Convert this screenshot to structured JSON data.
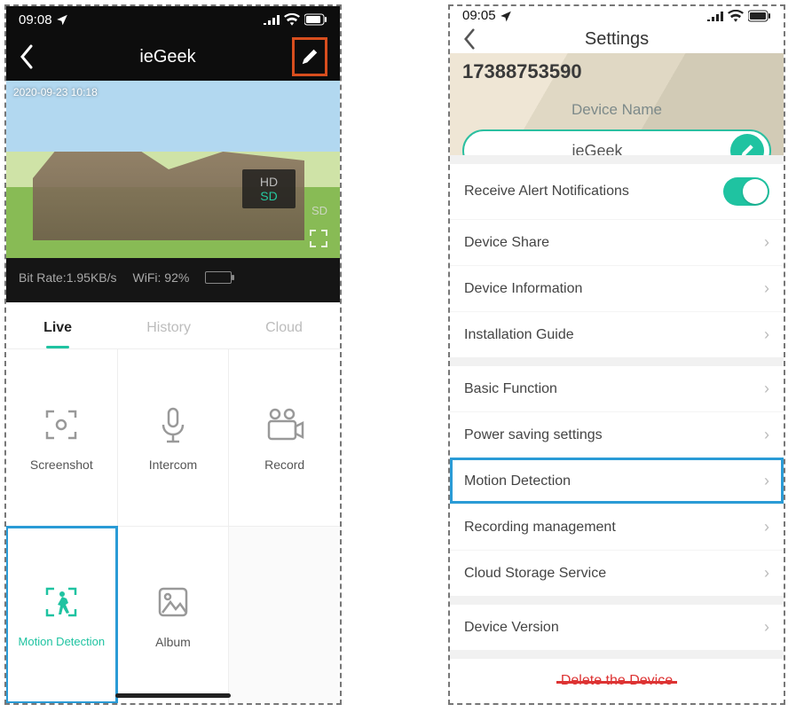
{
  "left": {
    "status_time": "09:08",
    "title": "ieGeek",
    "video_ts": "2020-09-23 10:18",
    "quality": {
      "hd": "HD",
      "sd": "SD",
      "sd2": "SD",
      "active": "sd"
    },
    "info": {
      "bitrate": "Bit Rate:1.95KB/s",
      "wifi": "WiFi: 92%"
    },
    "tabs": {
      "live": "Live",
      "history": "History",
      "cloud": "Cloud"
    },
    "cells": {
      "screenshot": "Screenshot",
      "intercom": "Intercom",
      "record": "Record",
      "motion": "Motion Detection",
      "album": "Album"
    }
  },
  "right": {
    "status_time": "09:05",
    "title": "Settings",
    "device_id": "17388753590",
    "device_name_label": "Device Name",
    "device_name_value": "ieGeek",
    "rows": {
      "alerts": "Receive Alert Notifications",
      "share": "Device Share",
      "info": "Device Information",
      "install": "Installation Guide",
      "basic": "Basic Function",
      "power": "Power saving settings",
      "motion": "Motion Detection",
      "recording": "Recording management",
      "cloud": "Cloud Storage Service",
      "version": "Device Version"
    },
    "delete": "Delete the Device"
  },
  "colors": {
    "accent": "#1fc3a1",
    "highlight_blue": "#2a9bd6",
    "highlight_orange": "#d84e1e"
  }
}
